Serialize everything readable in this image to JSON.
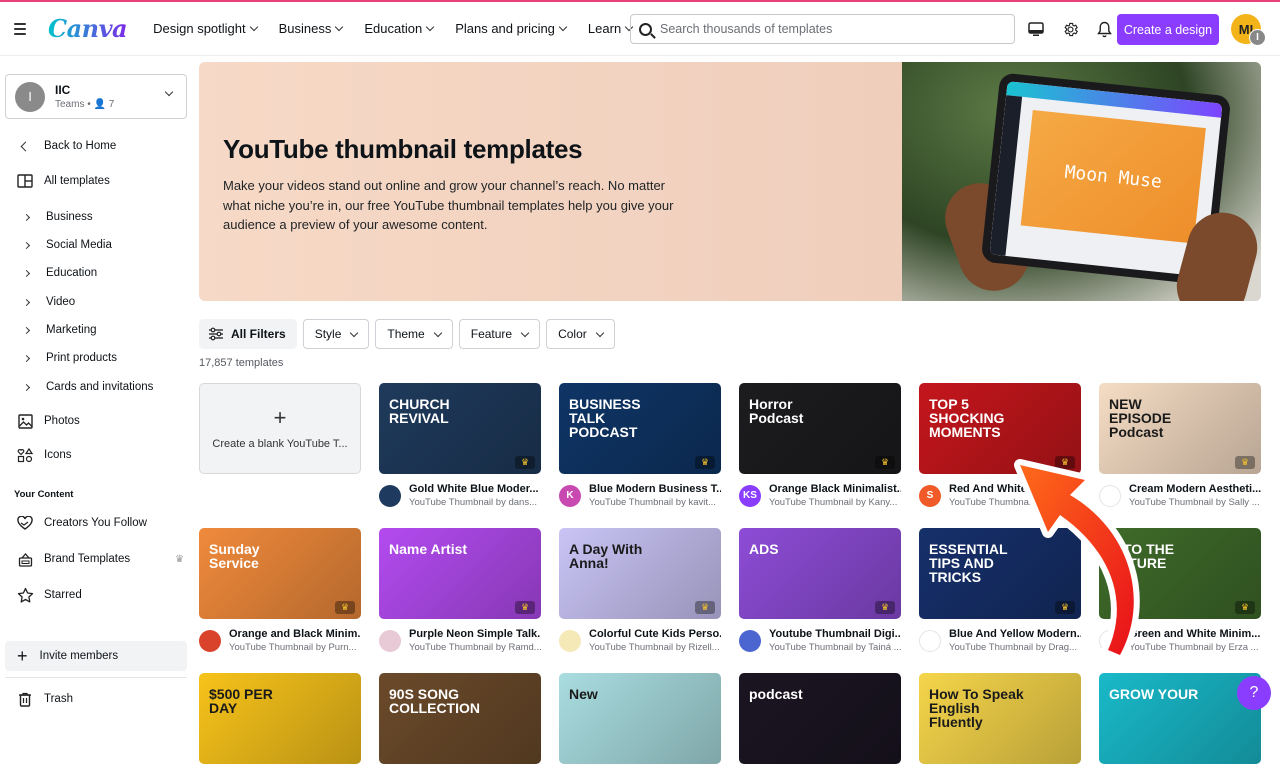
{
  "header": {
    "logo": "Canva",
    "nav": [
      {
        "label": "Design spotlight"
      },
      {
        "label": "Business"
      },
      {
        "label": "Education"
      },
      {
        "label": "Plans and pricing"
      },
      {
        "label": "Learn"
      }
    ],
    "search_placeholder": "Search thousands of templates",
    "create_label": "Create a design",
    "avatar_initials": "MI",
    "avatar_badge": "I",
    "accent": "#8b3dff"
  },
  "sidebar": {
    "team": {
      "initial": "I",
      "name": "IIC",
      "meta": "Teams • 👤 7"
    },
    "back": "Back to Home",
    "all_templates": "All templates",
    "categories": [
      {
        "label": "Business"
      },
      {
        "label": "Social Media"
      },
      {
        "label": "Education"
      },
      {
        "label": "Video"
      },
      {
        "label": "Marketing"
      },
      {
        "label": "Print products"
      },
      {
        "label": "Cards and invitations"
      }
    ],
    "photos": "Photos",
    "icons": "Icons",
    "your_content_title": "Your Content",
    "creators": "Creators You Follow",
    "brand_templates": "Brand Templates",
    "starred": "Starred",
    "invite": "Invite members",
    "trash": "Trash"
  },
  "hero": {
    "title": "YouTube thumbnail templates",
    "description": "Make your videos stand out online and grow your channel’s reach. No matter what niche you’re in, our free YouTube thumbnail templates help you give your audience a preview of your awesome content.",
    "tablet_text": "Moon Muse"
  },
  "filters": {
    "all": "All Filters",
    "items": [
      {
        "label": "Style"
      },
      {
        "label": "Theme"
      },
      {
        "label": "Feature"
      },
      {
        "label": "Color"
      }
    ],
    "count": "17,857 templates"
  },
  "blank_card": {
    "label": "Create a blank YouTube T..."
  },
  "templates": [
    {
      "title": "Gold White Blue Moder...",
      "sub": "YouTube Thumbnail by dans...",
      "thumb_text": "CHURCH REVIVAL",
      "bg": "#1f3a5c",
      "avatar": "",
      "avatar_bg": "#1e3a5f"
    },
    {
      "title": "Blue Modern Business T...",
      "sub": "YouTube Thumbnail by kavit...",
      "thumb_text": "BUSINESS TALK PODCAST",
      "bg": "#0f3566",
      "avatar": "K",
      "avatar_bg": "#c84ab0"
    },
    {
      "title": "Orange Black Minimalist...",
      "sub": "YouTube Thumbnail by Kany...",
      "thumb_text": "Horror Podcast",
      "bg": "#1c1c1f",
      "avatar": "KS",
      "avatar_bg": "#8b3dff"
    },
    {
      "title": "Red And White",
      "sub": "YouTube Thumbnai",
      "thumb_text": "TOP 5 SHOCKING MOMENTS",
      "bg": "#c4161c",
      "avatar": "S",
      "avatar_bg": "#f05a28"
    },
    {
      "title": "Cream Modern Aestheti...",
      "sub": "YouTube Thumbnail by Sally ...",
      "thumb_text": "NEW EPISODE Podcast",
      "bg": "#f5dcc4",
      "avatar": "",
      "avatar_bg": "#ffffff"
    },
    {
      "title": "Orange and Black Minim...",
      "sub": "YouTube Thumbnail by Purn...",
      "thumb_text": "Sunday Service",
      "bg": "#f08a3c",
      "avatar": "",
      "avatar_bg": "#d9432b"
    },
    {
      "title": "Purple Neon Simple Talk...",
      "sub": "YouTube Thumbnail by Ramd...",
      "thumb_text": "Name Artist",
      "bg": "#b34bf0",
      "avatar": "",
      "avatar_bg": "#e8c9d6"
    },
    {
      "title": "Colorful Cute Kids Perso...",
      "sub": "YouTube Thumbnail by Rizell...",
      "thumb_text": "A Day With Anna!",
      "bg": "#c9c4f5",
      "avatar": "",
      "avatar_bg": "#f6e9b8"
    },
    {
      "title": "Youtube Thumbnail Digi...",
      "sub": "YouTube Thumbnail by Tainá ...",
      "thumb_text": "ADS",
      "bg": "#8d4cd6",
      "avatar": "",
      "avatar_bg": "#4b66d1"
    },
    {
      "title": "Blue And Yellow Modern...",
      "sub": "YouTube Thumbnail by Drag...",
      "thumb_text": "ESSENTIAL TIPS AND TRICKS",
      "bg": "#16306b",
      "avatar": "",
      "avatar_bg": "#ffffff"
    },
    {
      "title": "Green and White Minim...",
      "sub": "YouTube Thumbnail by Erza ...",
      "thumb_text": "INTO THE NATURE",
      "bg": "#3f6b2a",
      "avatar": "",
      "avatar_bg": "#ffffff"
    },
    {
      "title": "",
      "sub": "",
      "thumb_text": "$500 PER DAY",
      "bg": "#f7c31a"
    },
    {
      "title": "",
      "sub": "",
      "thumb_text": "90S SONG COLLECTION",
      "bg": "#6b4a2a"
    },
    {
      "title": "",
      "sub": "",
      "thumb_text": "New",
      "bg": "#a9dde0"
    },
    {
      "title": "",
      "sub": "",
      "thumb_text": "podcast",
      "bg": "#1b1522"
    },
    {
      "title": "",
      "sub": "",
      "thumb_text": "How To Speak English Fluently",
      "bg": "#f5d54a"
    },
    {
      "title": "",
      "sub": "",
      "thumb_text": "GROW YOUR",
      "bg": "#19b9c9"
    }
  ],
  "help_label": "?"
}
